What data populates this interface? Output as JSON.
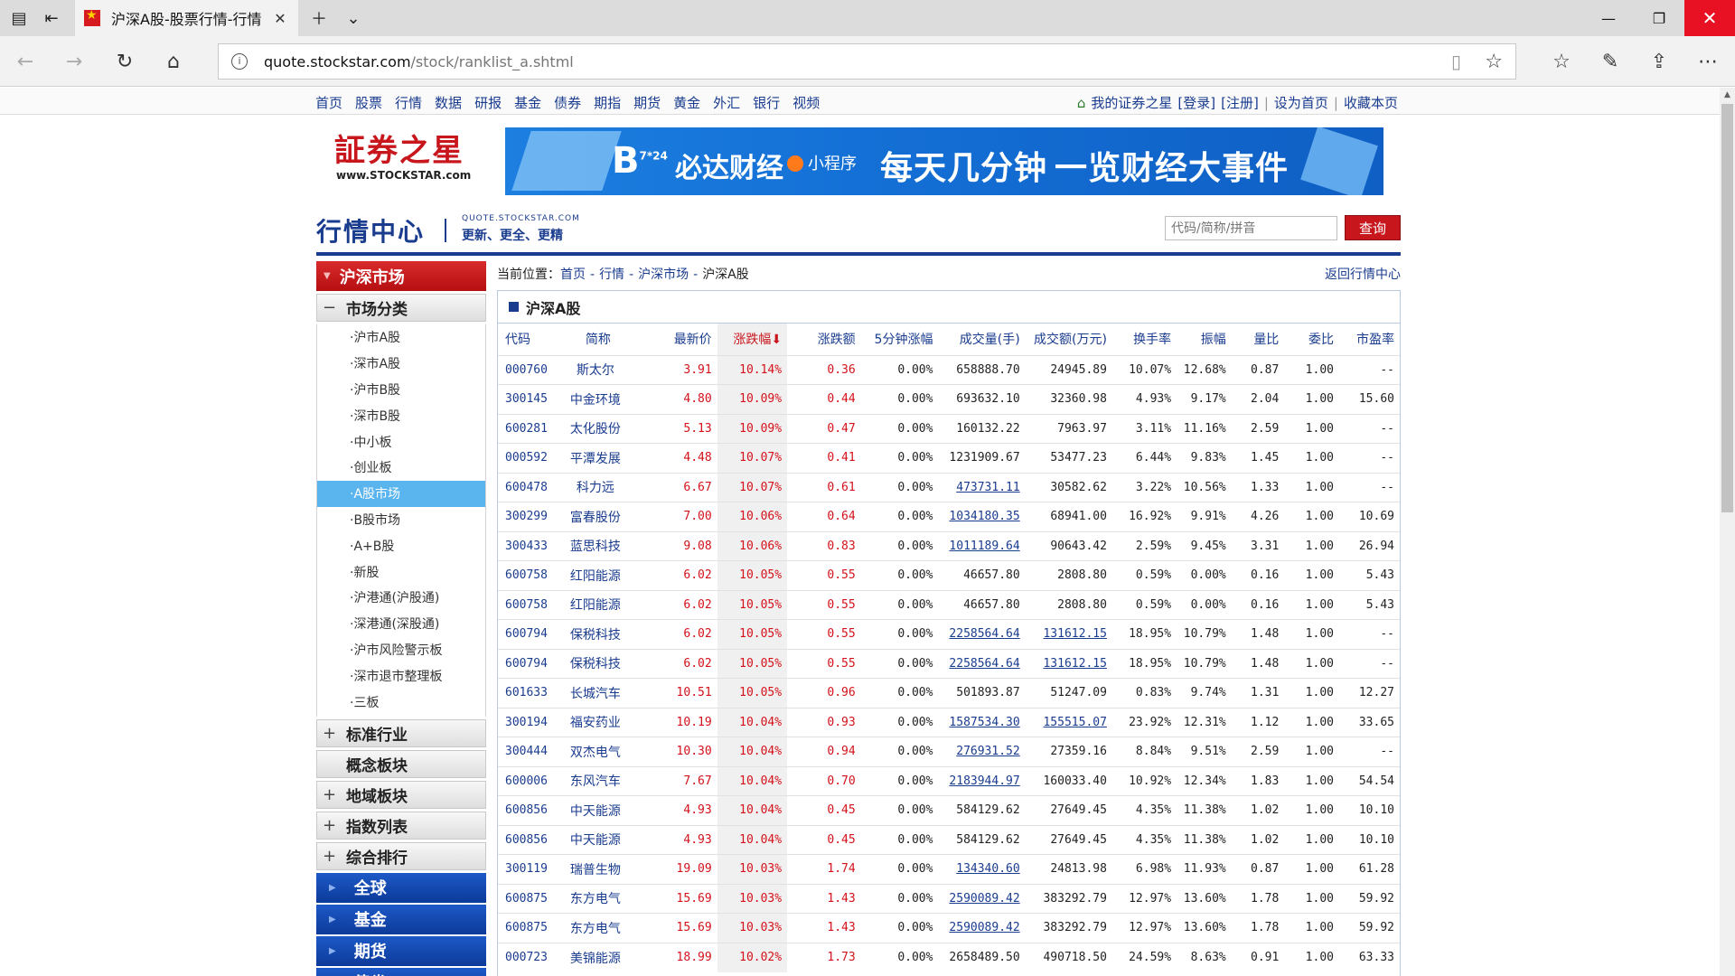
{
  "browser": {
    "tab_title": "沪深A股-股票行情-行情",
    "url_host": "quote.stockstar.com",
    "url_path": "/stock/ranklist_a.shtml"
  },
  "topnav": {
    "links": [
      "首页",
      "股票",
      "行情",
      "数据",
      "研报",
      "基金",
      "债券",
      "期指",
      "期货",
      "黄金",
      "外汇",
      "银行",
      "视频"
    ],
    "my_star": "我的证券之星",
    "login": "[登录]",
    "register": "[注册]",
    "sep": "|",
    "set_home": "设为首页",
    "bookmark": "收藏本页"
  },
  "logo": {
    "brand": "証券之星",
    "en": "www.STOCKSTAR.com"
  },
  "banner": {
    "b7": "B",
    "b7_sup": "7*24",
    "t1": "必达财经",
    "t2": "小程序",
    "t3": "每天几分钟",
    "t4": "一览财经大事件"
  },
  "header": {
    "title": "行情中心",
    "sub_en": "QUOTE.STOCKSTAR.COM",
    "sub_cn": "更新、更全、更精",
    "search_placeholder": "代码/简称/拼音",
    "search_button": "查询"
  },
  "sidebar": {
    "main": "沪深市场",
    "group_market": "市场分类",
    "items": [
      "·沪市A股",
      "·深市A股",
      "·沪市B股",
      "·深市B股",
      "·中小板",
      "·创业板",
      "·A股市场",
      "·B股市场",
      "·A+B股",
      "·新股",
      "·沪港通(沪股通)",
      "·深港通(深股通)",
      "·沪市风险警示板",
      "·深市退市整理板",
      "·三板"
    ],
    "groups": [
      {
        "sign": "+",
        "label": "标准行业"
      },
      {
        "sign": "",
        "label": "概念板块"
      },
      {
        "sign": "+",
        "label": "地域板块"
      },
      {
        "sign": "+",
        "label": "指数列表"
      },
      {
        "sign": "+",
        "label": "综合排行"
      }
    ],
    "blue": [
      "全球",
      "基金",
      "期货",
      "债券"
    ]
  },
  "crumb": {
    "label": "当前位置：",
    "links": [
      "首页",
      "行情",
      "沪深市场"
    ],
    "current": "沪深A股",
    "dash": "-",
    "back": "返回行情中心"
  },
  "table": {
    "title": "沪深A股",
    "columns": [
      "代码",
      "简称",
      "最新价",
      "涨跌幅⬇",
      "涨跌额",
      "5分钟涨幅",
      "成交量(手)",
      "成交额(万元)",
      "换手率",
      "振幅",
      "量比",
      "委比",
      "市盈率"
    ],
    "rows": [
      [
        "000760",
        "斯太尔",
        "3.91",
        "10.14%",
        "0.36",
        "0.00%",
        "658888.70",
        "24945.89",
        "10.07%",
        "12.68%",
        "0.87",
        "1.00",
        "--"
      ],
      [
        "300145",
        "中金环境",
        "4.80",
        "10.09%",
        "0.44",
        "0.00%",
        "693632.10",
        "32360.98",
        "4.93%",
        "9.17%",
        "2.04",
        "1.00",
        "15.60"
      ],
      [
        "600281",
        "太化股份",
        "5.13",
        "10.09%",
        "0.47",
        "0.00%",
        "160132.22",
        "7963.97",
        "3.11%",
        "11.16%",
        "2.59",
        "1.00",
        "--"
      ],
      [
        "000592",
        "平潭发展",
        "4.48",
        "10.07%",
        "0.41",
        "0.00%",
        "1231909.67",
        "53477.23",
        "6.44%",
        "9.83%",
        "1.45",
        "1.00",
        "--"
      ],
      [
        "600478",
        "科力远",
        "6.67",
        "10.07%",
        "0.61",
        "0.00%",
        "473731.11",
        "30582.62",
        "3.22%",
        "10.56%",
        "1.33",
        "1.00",
        "--"
      ],
      [
        "300299",
        "富春股份",
        "7.00",
        "10.06%",
        "0.64",
        "0.00%",
        "1034180.35",
        "68941.00",
        "16.92%",
        "9.91%",
        "4.26",
        "1.00",
        "10.69"
      ],
      [
        "300433",
        "蓝思科技",
        "9.08",
        "10.06%",
        "0.83",
        "0.00%",
        "1011189.64",
        "90643.42",
        "2.59%",
        "9.45%",
        "3.31",
        "1.00",
        "26.94"
      ],
      [
        "600758",
        "红阳能源",
        "6.02",
        "10.05%",
        "0.55",
        "0.00%",
        "46657.80",
        "2808.80",
        "0.59%",
        "0.00%",
        "0.16",
        "1.00",
        "5.43"
      ],
      [
        "600758",
        "红阳能源",
        "6.02",
        "10.05%",
        "0.55",
        "0.00%",
        "46657.80",
        "2808.80",
        "0.59%",
        "0.00%",
        "0.16",
        "1.00",
        "5.43"
      ],
      [
        "600794",
        "保税科技",
        "6.02",
        "10.05%",
        "0.55",
        "0.00%",
        "2258564.64",
        "131612.15",
        "18.95%",
        "10.79%",
        "1.48",
        "1.00",
        "--"
      ],
      [
        "600794",
        "保税科技",
        "6.02",
        "10.05%",
        "0.55",
        "0.00%",
        "2258564.64",
        "131612.15",
        "18.95%",
        "10.79%",
        "1.48",
        "1.00",
        "--"
      ],
      [
        "601633",
        "长城汽车",
        "10.51",
        "10.05%",
        "0.96",
        "0.00%",
        "501893.87",
        "51247.09",
        "0.83%",
        "9.74%",
        "1.31",
        "1.00",
        "12.27"
      ],
      [
        "300194",
        "福安药业",
        "10.19",
        "10.04%",
        "0.93",
        "0.00%",
        "1587534.30",
        "155515.07",
        "23.92%",
        "12.31%",
        "1.12",
        "1.00",
        "33.65"
      ],
      [
        "300444",
        "双杰电气",
        "10.30",
        "10.04%",
        "0.94",
        "0.00%",
        "276931.52",
        "27359.16",
        "8.84%",
        "9.51%",
        "2.59",
        "1.00",
        "--"
      ],
      [
        "600006",
        "东风汽车",
        "7.67",
        "10.04%",
        "0.70",
        "0.00%",
        "2183944.97",
        "160033.40",
        "10.92%",
        "12.34%",
        "1.83",
        "1.00",
        "54.54"
      ],
      [
        "600856",
        "中天能源",
        "4.93",
        "10.04%",
        "0.45",
        "0.00%",
        "584129.62",
        "27649.45",
        "4.35%",
        "11.38%",
        "1.02",
        "1.00",
        "10.10"
      ],
      [
        "600856",
        "中天能源",
        "4.93",
        "10.04%",
        "0.45",
        "0.00%",
        "584129.62",
        "27649.45",
        "4.35%",
        "11.38%",
        "1.02",
        "1.00",
        "10.10"
      ],
      [
        "300119",
        "瑞普生物",
        "19.09",
        "10.03%",
        "1.74",
        "0.00%",
        "134340.60",
        "24813.98",
        "6.98%",
        "11.93%",
        "0.87",
        "1.00",
        "61.28"
      ],
      [
        "600875",
        "东方电气",
        "15.69",
        "10.03%",
        "1.43",
        "0.00%",
        "2590089.42",
        "383292.79",
        "12.97%",
        "13.60%",
        "1.78",
        "1.00",
        "59.92"
      ],
      [
        "600875",
        "东方电气",
        "15.69",
        "10.03%",
        "1.43",
        "0.00%",
        "2590089.42",
        "383292.79",
        "12.97%",
        "13.60%",
        "1.78",
        "1.00",
        "59.92"
      ],
      [
        "000723",
        "美锦能源",
        "18.99",
        "10.02%",
        "1.73",
        "0.00%",
        "2658489.50",
        "490718.50",
        "24.59%",
        "8.63%",
        "0.91",
        "1.00",
        "63.33"
      ]
    ],
    "linked_cells": [
      [
        4,
        6
      ],
      [
        5,
        6
      ],
      [
        6,
        6
      ],
      [
        9,
        6
      ],
      [
        9,
        7
      ],
      [
        10,
        6
      ],
      [
        10,
        7
      ],
      [
        12,
        6
      ],
      [
        12,
        7
      ],
      [
        13,
        6
      ],
      [
        14,
        6
      ],
      [
        17,
        6
      ],
      [
        18,
        6
      ],
      [
        19,
        6
      ]
    ]
  }
}
